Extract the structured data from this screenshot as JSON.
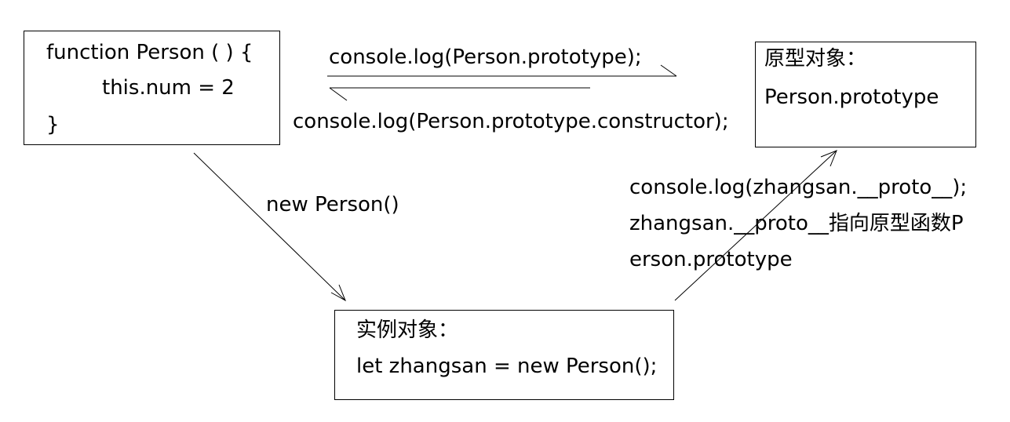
{
  "function_box": {
    "line1": "function Person (  ) {",
    "line2": "this.num = 2",
    "line3": "}"
  },
  "prototype_box": {
    "title": "原型对象：",
    "name": "Person.prototype"
  },
  "instance_box": {
    "title": "实例对象：",
    "code": "let zhangsan = new Person();"
  },
  "labels": {
    "top_arrow": "console.log(Person.prototype);",
    "bottom_arrow": "console.log(Person.prototype.constructor);",
    "new_person": "new Person()",
    "proto_line1": "console.log(zhangsan.__proto__);",
    "proto_line2": "zhangsan.__proto__指向原型函数P",
    "proto_line3": "erson.prototype"
  }
}
